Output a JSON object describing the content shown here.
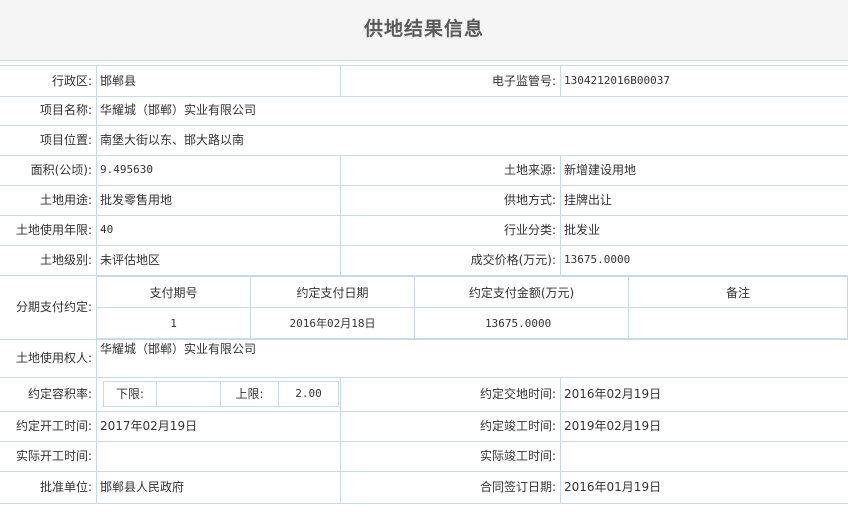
{
  "page": {
    "title": "供地结果信息"
  },
  "fields": {
    "district_label": "行政区:",
    "district_value": "邯郸县",
    "supervision_no_label": "电子监管号:",
    "supervision_no_value": "1304212016B00037",
    "project_name_label": "项目名称:",
    "project_name_value": "华耀城（邯郸）实业有限公司",
    "project_location_label": "项目位置:",
    "project_location_value": "南堡大街以东、邯大路以南",
    "area_label": "面积(公顷):",
    "area_value": "9.495630",
    "land_source_label": "土地来源:",
    "land_source_value": "新增建设用地",
    "land_use_label": "土地用途:",
    "land_use_value": "批发零售用地",
    "supply_method_label": "供地方式:",
    "supply_method_value": "挂牌出让",
    "use_years_label": "土地使用年限:",
    "use_years_value": "40",
    "industry_label": "行业分类:",
    "industry_value": "批发业",
    "land_grade_label": "土地级别:",
    "land_grade_value": "未评估地区",
    "price_label": "成交价格(万元):",
    "price_value": "13675.0000",
    "installment_label": "分期支付约定:",
    "land_user_label": "土地使用权人:",
    "land_user_value": "华耀城（邯郸）实业有限公司",
    "far_label": "约定容积率:",
    "far_lower_label": "下限:",
    "far_lower_value": "",
    "far_upper_label": "上限:",
    "far_upper_value": "2.00",
    "delivery_time_label": "约定交地时间:",
    "delivery_time_value": "2016年02月19日",
    "start_time_label": "约定开工时间:",
    "start_time_value": "2017年02月19日",
    "completion_time_label": "约定竣工时间:",
    "completion_time_value": "2019年02月19日",
    "actual_start_label": "实际开工时间:",
    "actual_start_value": "",
    "actual_completion_label": "实际竣工时间:",
    "actual_completion_value": "",
    "approval_unit_label": "批准单位:",
    "approval_unit_value": "邯郸县人民政府",
    "contract_date_label": "合同签订日期:",
    "contract_date_value": "2016年01月19日"
  },
  "installments": {
    "headers": [
      "支付期号",
      "约定支付日期",
      "约定支付金额(万元)",
      "备注"
    ],
    "rows": [
      [
        "1",
        "2016年02月18日",
        "13675.0000",
        ""
      ]
    ]
  }
}
